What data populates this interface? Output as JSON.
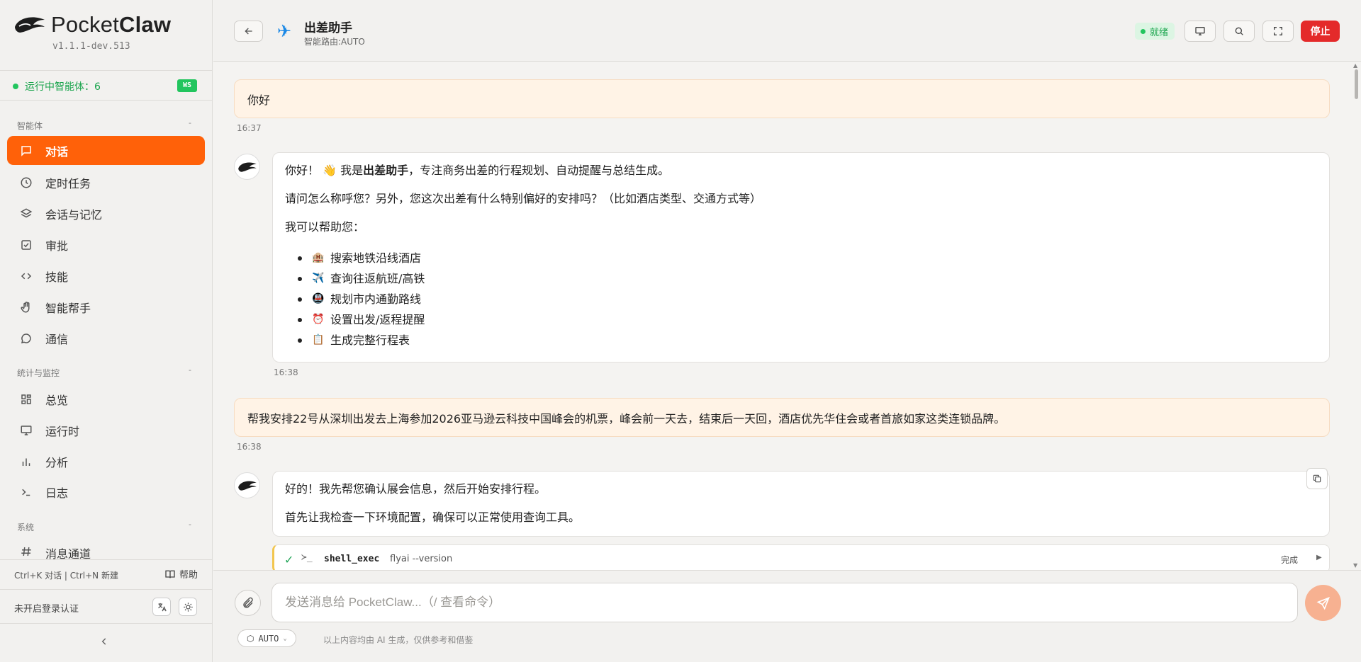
{
  "app": {
    "name_light": "Pocket",
    "name_bold": "Claw",
    "version": "v1.1.1-dev.513",
    "agents_running": "运行中智能体：6",
    "ws_badge": "WS"
  },
  "sidebar": {
    "sections": [
      {
        "title": "智能体",
        "items": [
          {
            "label": "对话",
            "icon": "chat-icon",
            "active": true
          },
          {
            "label": "定时任务",
            "icon": "clock-icon"
          },
          {
            "label": "会话与记忆",
            "icon": "layers-icon"
          },
          {
            "label": "审批",
            "icon": "checkbox-icon"
          },
          {
            "label": "技能",
            "icon": "code-icon"
          },
          {
            "label": "智能帮手",
            "icon": "hand-icon"
          },
          {
            "label": "通信",
            "icon": "message-icon"
          }
        ]
      },
      {
        "title": "统计与监控",
        "items": [
          {
            "label": "总览",
            "icon": "grid-icon"
          },
          {
            "label": "运行时",
            "icon": "monitor-icon"
          },
          {
            "label": "分析",
            "icon": "bar-chart-icon"
          },
          {
            "label": "日志",
            "icon": "terminal-icon"
          }
        ]
      },
      {
        "title": "系统",
        "items": [
          {
            "label": "消息通道",
            "icon": "hash-icon"
          }
        ]
      }
    ],
    "shortcuts": "Ctrl+K 对话 | Ctrl+N 新建",
    "help": "帮助",
    "auth": "未开启登录认证"
  },
  "header": {
    "agent_icon": "airplane-icon",
    "agent_name": "出差助手",
    "route": "智能路由:AUTO",
    "status": "就绪",
    "stop": "停止"
  },
  "messages": {
    "m1": {
      "text": "你好",
      "time": "16:37"
    },
    "m2": {
      "p1_a": "你好！",
      "p1_wave": "👋",
      "p1_b": "我是",
      "p1_bold": "出差助手",
      "p1_c": "，专注商务出差的行程规划、自动提醒与总结生成。",
      "p2": "请问怎么称呼您？另外，您这次出差有什么特别偏好的安排吗？（比如酒店类型、交通方式等）",
      "p3": "我可以帮助您：",
      "items": [
        {
          "emoji": "🏨",
          "text": "搜索地铁沿线酒店"
        },
        {
          "emoji": "✈️",
          "text": "查询往返航班/高铁"
        },
        {
          "emoji": "🚇",
          "text": "规划市内通勤路线"
        },
        {
          "emoji": "⏰",
          "text": "设置出发/返程提醒"
        },
        {
          "emoji": "📋",
          "text": "生成完整行程表"
        }
      ],
      "time": "16:38"
    },
    "m3": {
      "text": "帮我安排22号从深圳出发去上海参加2026亚马逊云科技中国峰会的机票，峰会前一天去，结束后一天回，酒店优先华住会或者首旅如家这类连锁品牌。",
      "time": "16:38"
    },
    "m4": {
      "p1": "好的！我先帮您确认展会信息，然后开始安排行程。",
      "p2": "首先让我检查一下环境配置，确保可以正常使用查询工具。"
    },
    "tool": {
      "prompt": "≻_",
      "name": "shell_exec",
      "cmd": "flyai --version",
      "status": "完成"
    }
  },
  "composer": {
    "placeholder": "发送消息给 PocketClaw...（/ 查看命令）",
    "mode": "AUTO",
    "disclaimer": "以上内容均由 AI 生成，仅供参考和借鉴"
  }
}
